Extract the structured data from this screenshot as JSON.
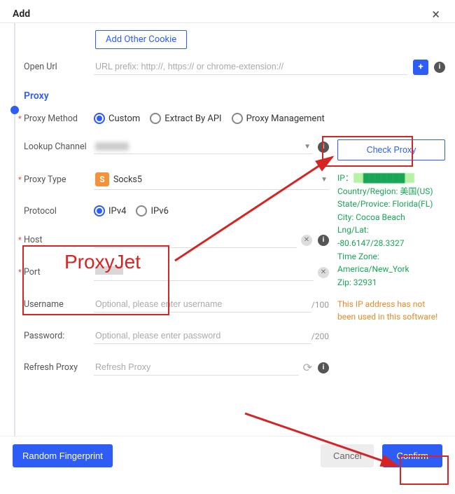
{
  "header": {
    "title": "Add"
  },
  "cookie": {
    "add_other": "Add Other Cookie"
  },
  "open_url": {
    "label": "Open Url",
    "placeholder": "URL prefix: http://, https:// or chrome-extension://"
  },
  "proxy": {
    "section": "Proxy",
    "method_label": "Proxy Method",
    "methods": {
      "custom": "Custom",
      "api": "Extract By API",
      "mgmt": "Proxy Management"
    },
    "lookup_label": "Lookup Channel",
    "check_btn": "Check Proxy",
    "type_label": "Proxy Type",
    "type_value": "Socks5",
    "protocol_label": "Protocol",
    "protocols": {
      "ipv4": "IPv4",
      "ipv6": "IPv6"
    },
    "host_label": "Host",
    "port_label": "Port",
    "user_label": "Username",
    "user_ph": "Optional, please enter username",
    "user_max": "/100",
    "pass_label": "Password:",
    "pass_ph": "Optional, please enter password",
    "pass_max": "/200",
    "refresh_label": "Refresh Proxy",
    "refresh_ph": "Refresh Proxy"
  },
  "ip": {
    "head": "IP：",
    "country": "Country/Region: 美国(US)",
    "state": "State/Provice: Florida(FL)",
    "city": "City: Cocoa Beach",
    "lnglat_l": "Lng/Lat:",
    "lnglat_v": "-80.6147/28.3327",
    "tz_l": "Time Zone:",
    "tz_v": "America/New_York",
    "zip": "Zip: 32931",
    "warn": "This IP address has not been used in this software!"
  },
  "footer": {
    "random": "Random Fingerprint",
    "cancel": "Cancel",
    "confirm": "Confirm"
  },
  "annot": {
    "proxyjet": "ProxyJet"
  }
}
